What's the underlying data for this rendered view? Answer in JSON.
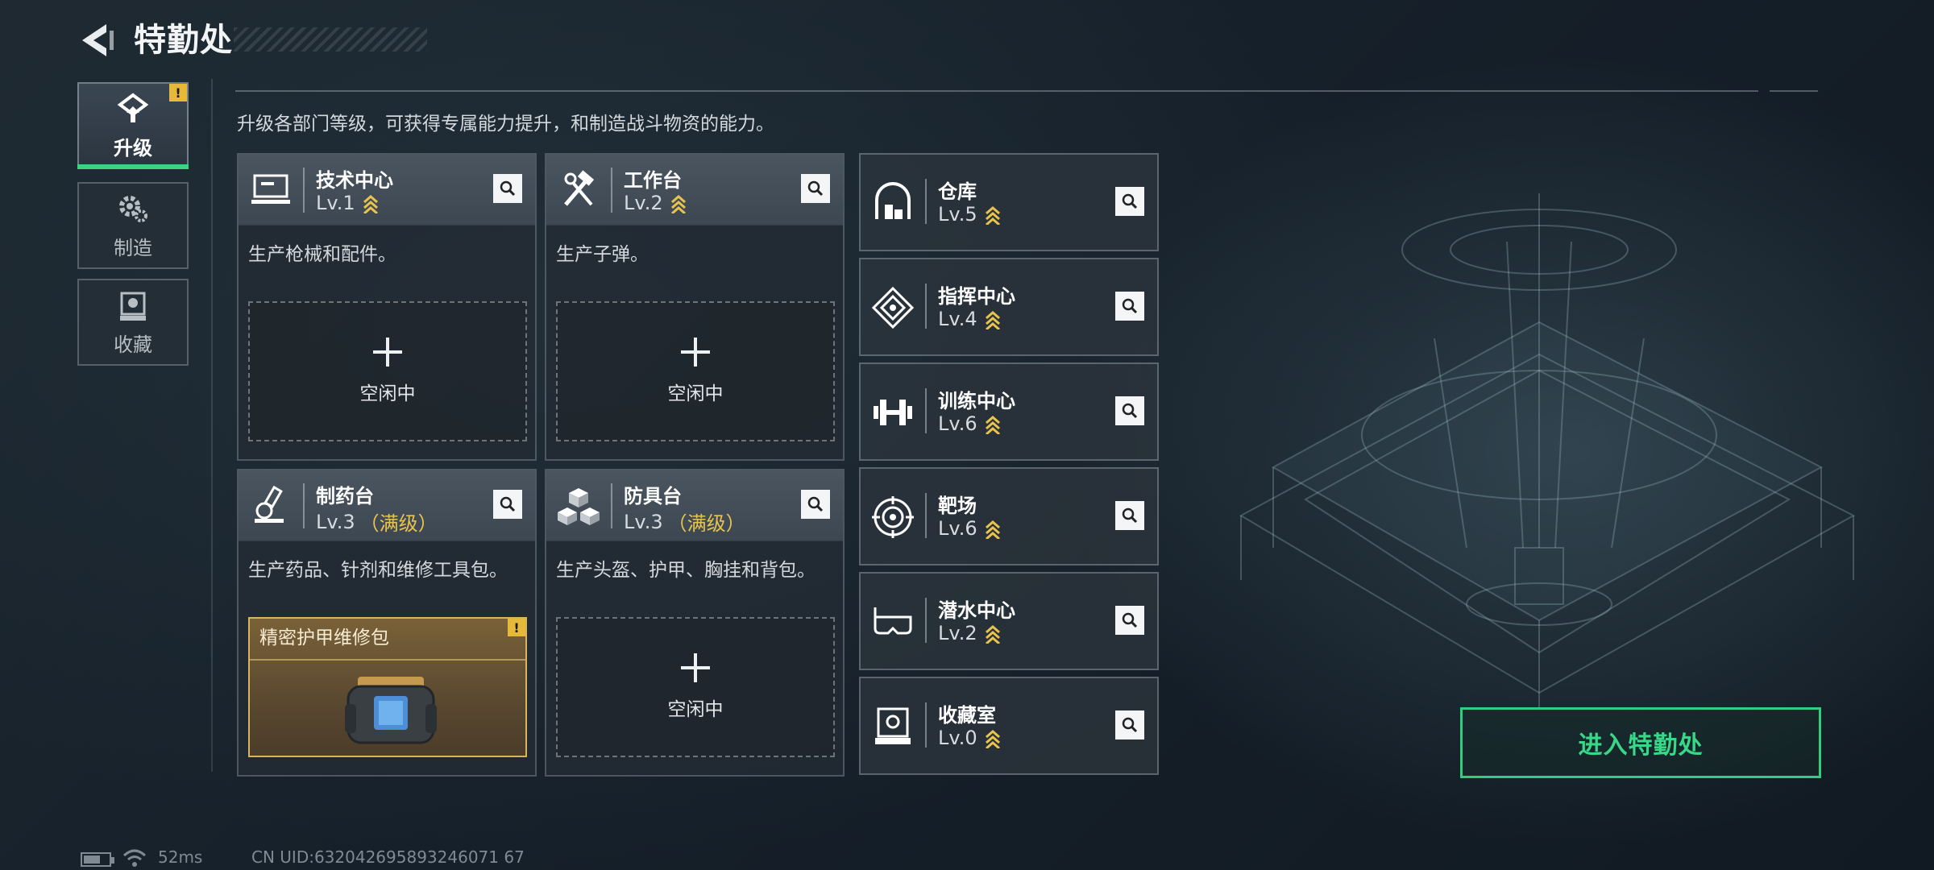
{
  "header": {
    "title": "特勤处"
  },
  "side_nav": [
    {
      "label": "升级",
      "icon": "upgrade-icon",
      "active": true,
      "badge": "!"
    },
    {
      "label": "制造",
      "icon": "gears-icon",
      "active": false
    },
    {
      "label": "收藏",
      "icon": "collection-icon",
      "active": false
    }
  ],
  "description": "升级各部门等级，可获得专属能力提升，和制造战斗物资的能力。",
  "big_cards": [
    {
      "name": "技术中心",
      "level": "Lv.1",
      "maxed": "",
      "desc": "生产枪械和配件。",
      "slot": "空闲中",
      "icon": "tech-center-icon"
    },
    {
      "name": "工作台",
      "level": "Lv.2",
      "maxed": "",
      "desc": "生产子弹。",
      "slot": "空闲中",
      "icon": "workbench-icon"
    },
    {
      "name": "制药台",
      "level": "Lv.3",
      "maxed": "（满级）",
      "desc": "生产药品、针剂和维修工具包。",
      "item": "精密护甲维修包",
      "icon": "pharmacy-icon"
    },
    {
      "name": "防具台",
      "level": "Lv.3",
      "maxed": "（满级）",
      "desc": "生产头盔、护甲、胸挂和背包。",
      "slot": "空闲中",
      "icon": "armor-bench-icon"
    }
  ],
  "small_cards": [
    {
      "name": "仓库",
      "level": "Lv.5",
      "icon": "warehouse-icon"
    },
    {
      "name": "指挥中心",
      "level": "Lv.4",
      "icon": "command-center-icon"
    },
    {
      "name": "训练中心",
      "level": "Lv.6",
      "icon": "dumbbell-icon"
    },
    {
      "name": "靶场",
      "level": "Lv.6",
      "icon": "target-icon"
    },
    {
      "name": "潜水中心",
      "level": "Lv.2",
      "icon": "diving-mask-icon"
    },
    {
      "name": "收藏室",
      "level": "Lv.0",
      "icon": "trophy-case-icon"
    }
  ],
  "enter_button": "进入特勤处",
  "status": {
    "ping": "52ms",
    "uid": "CN UID:632042695893246071 67"
  },
  "colors": {
    "accent_green": "#37d887",
    "gold": "#e8c34d",
    "warning": "#e7b93a"
  }
}
